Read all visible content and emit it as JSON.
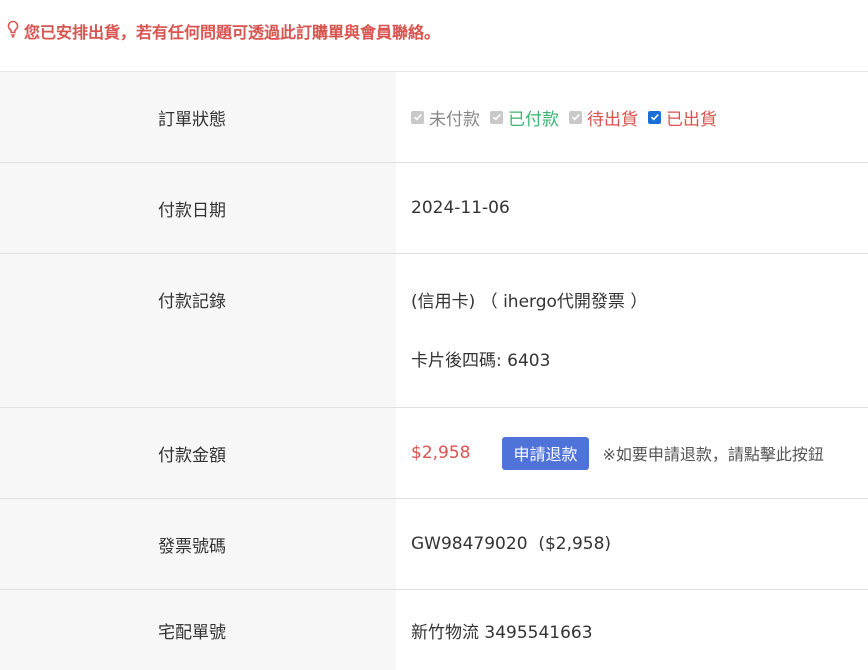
{
  "notice": {
    "text": "您已安排出貨，若有任何問題可透過此訂購單與會員聯絡。"
  },
  "rows": {
    "status": {
      "label": "訂單狀態",
      "options": [
        {
          "text": "未付款",
          "checked": true,
          "disabled": true,
          "color": "#888888"
        },
        {
          "text": "已付款",
          "checked": true,
          "disabled": true,
          "color": "#3cb371"
        },
        {
          "text": "待出貨",
          "checked": true,
          "disabled": true,
          "color": "#d9534f"
        },
        {
          "text": "已出貨",
          "checked": true,
          "disabled": false,
          "color": "#d9534f"
        }
      ]
    },
    "pay_date": {
      "label": "付款日期",
      "value": "2024-11-06"
    },
    "pay_record": {
      "label": "付款記錄",
      "line1": "(信用卡) （ ihergo代開發票 ）",
      "line2": "卡片後四碼: 6403"
    },
    "pay_amount": {
      "label": "付款金額",
      "amount": "$2,958",
      "refund_button": "申請退款",
      "refund_note": "※如要申請退款，請點擊此按鈕"
    },
    "invoice": {
      "label": "發票號碼",
      "value": "GW98479020  ($2,958)"
    },
    "shipping": {
      "label": "宅配單號",
      "value": "新竹物流 3495541663"
    }
  },
  "colors": {
    "alert": "#d9534f",
    "paid": "#3cb371",
    "button": "#4f73d9"
  }
}
